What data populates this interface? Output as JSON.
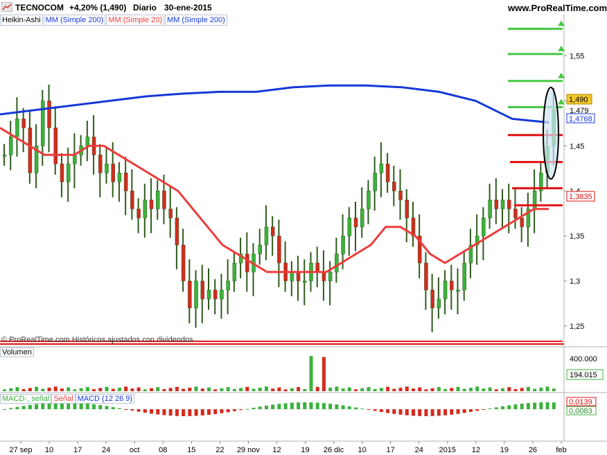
{
  "header": {
    "symbol": "TECNOCOM",
    "change": "+4,20% (1,490)",
    "period": "Diario",
    "date": "30-ene-2015",
    "brand": "www.ProRealTime.com"
  },
  "indicators": {
    "heikin": "Heikin-Ashi",
    "mm200a": "MM (Simple 200)",
    "mm20": "MM (Simple 20)",
    "mm200b": "MM (Simple 200)"
  },
  "copyright": "© ProRealTime.com  Históricos ajustados con dividendos",
  "volume_panel": {
    "label": "Volumen",
    "ticks": [
      "400.000"
    ],
    "last_value": "194.015"
  },
  "macd_panel": {
    "labels": [
      "MACD-, señal",
      "Señal",
      "MACD (12 26 9)"
    ],
    "value_red": "0,0139",
    "value_green": "0,0083"
  },
  "price_axis": {
    "ticks": [
      "1,55",
      "1,5",
      "1,45",
      "1,4",
      "1,35",
      "1,3",
      "1,25"
    ],
    "last_price": "1,490",
    "label_1479": "1,479",
    "label_blue": "1,4768",
    "label_red": "1,3835"
  },
  "x_axis": {
    "ticks": [
      "27 sep",
      "10",
      "17",
      "24",
      "oct",
      "08",
      "15",
      "22",
      "29 nov",
      "12",
      "19",
      "26 dic",
      "10",
      "17",
      "24",
      "2015",
      "12",
      "19",
      "26",
      "feb"
    ]
  },
  "colors": {
    "up": "#3bb23b",
    "down": "#d42b1e",
    "wick": "#2e5a1c",
    "ma200": "#1538d8",
    "ma20": "#ee3b3b",
    "level_green": "#46c846",
    "level_red": "#e01010"
  },
  "chart_data": {
    "type": "candlestick",
    "price_range": [
      1.23,
      1.595
    ],
    "candles_close": [
      1.44,
      1.46,
      1.48,
      1.47,
      1.42,
      1.45,
      1.5,
      1.47,
      1.43,
      1.41,
      1.43,
      1.44,
      1.45,
      1.46,
      1.44,
      1.42,
      1.43,
      1.41,
      1.42,
      1.4,
      1.38,
      1.37,
      1.39,
      1.38,
      1.4,
      1.38,
      1.37,
      1.34,
      1.3,
      1.27,
      1.3,
      1.28,
      1.29,
      1.28,
      1.29,
      1.3,
      1.32,
      1.33,
      1.31,
      1.33,
      1.34,
      1.36,
      1.35,
      1.32,
      1.3,
      1.31,
      1.3,
      1.3,
      1.32,
      1.31,
      1.3,
      1.31,
      1.33,
      1.35,
      1.37,
      1.36,
      1.38,
      1.4,
      1.42,
      1.43,
      1.41,
      1.4,
      1.39,
      1.37,
      1.35,
      1.32,
      1.29,
      1.27,
      1.28,
      1.3,
      1.29,
      1.29,
      1.32,
      1.34,
      1.35,
      1.37,
      1.39,
      1.38,
      1.39,
      1.38,
      1.37,
      1.36,
      1.38,
      1.4,
      1.42,
      1.45,
      1.49
    ],
    "ma20": [
      1.47,
      1.46,
      1.45,
      1.44,
      1.44,
      1.44,
      1.45,
      1.45,
      1.44,
      1.43,
      1.42,
      1.41,
      1.4,
      1.38,
      1.36,
      1.34,
      1.33,
      1.32,
      1.31,
      1.31,
      1.31,
      1.31,
      1.31,
      1.32,
      1.33,
      1.34,
      1.36,
      1.36,
      1.35,
      1.33,
      1.32,
      1.33,
      1.34,
      1.35,
      1.36,
      1.37,
      1.38,
      1.38
    ],
    "ma200": [
      1.485,
      1.49,
      1.495,
      1.5,
      1.505,
      1.508,
      1.51,
      1.51,
      1.515,
      1.517,
      1.517,
      1.515,
      1.51,
      1.5,
      1.48,
      1.476
    ],
    "green_levels": [
      1.58,
      1.552,
      1.522,
      1.493
    ],
    "red_levels": [
      1.462,
      1.432,
      1.403,
      1.384
    ],
    "bottom_level": 1.233,
    "volume_range": [
      0,
      450000
    ],
    "macd_values": [
      0.0139,
      0.0083
    ]
  }
}
